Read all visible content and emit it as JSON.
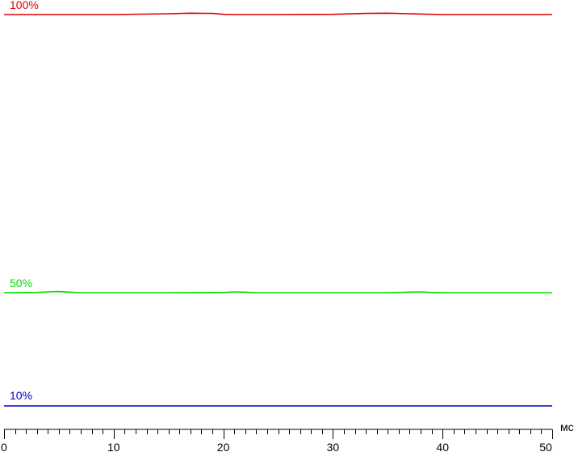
{
  "chart_data": {
    "type": "line",
    "title": "",
    "xlabel": "",
    "ylabel": "",
    "x_unit": "мс",
    "xlim": [
      0,
      50
    ],
    "x_major_ticks": [
      0,
      10,
      20,
      30,
      40,
      50
    ],
    "x_tick_labels": [
      "0",
      "10",
      "20",
      "30",
      "40",
      "50"
    ],
    "x_minor_step": 1,
    "grid": false,
    "legend": "none",
    "series": [
      {
        "name": "100%",
        "color": "#e00000",
        "x": [
          0,
          5,
          10,
          15,
          17,
          19,
          20,
          21,
          25,
          30,
          33,
          35,
          37,
          40,
          45,
          50
        ],
        "values": [
          100,
          100,
          100,
          100.15,
          100.25,
          100.2,
          100.05,
          100,
          100,
          100.05,
          100.2,
          100.25,
          100.15,
          100,
          100,
          100
        ]
      },
      {
        "name": "50%",
        "color": "#00e000",
        "x": [
          0,
          3,
          4,
          5,
          6,
          7,
          10,
          15,
          20,
          21,
          22,
          23,
          25,
          30,
          35,
          37,
          38,
          39,
          40,
          45,
          50
        ],
        "values": [
          50,
          50.05,
          50.15,
          50.2,
          50.1,
          50,
          50,
          50,
          50.05,
          50.15,
          50.1,
          50,
          50,
          50,
          50,
          50.1,
          50.15,
          50.05,
          50,
          50,
          50
        ]
      },
      {
        "name": "10%",
        "color": "#0000cc",
        "x": [
          0,
          10,
          20,
          30,
          40,
          50
        ],
        "values": [
          10,
          10,
          10,
          10,
          10,
          10
        ]
      }
    ]
  }
}
